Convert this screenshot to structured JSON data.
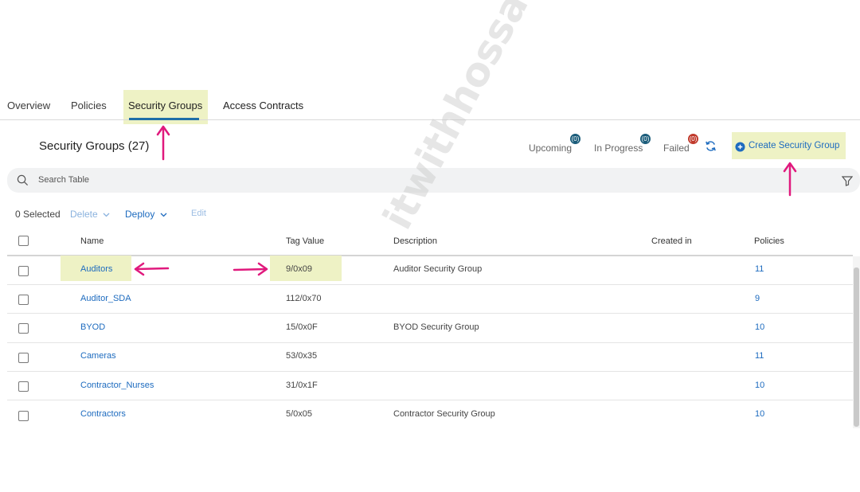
{
  "tabs": [
    {
      "label": "Overview"
    },
    {
      "label": "Policies"
    },
    {
      "label": "Security Groups",
      "active": true
    },
    {
      "label": "Access Contracts"
    }
  ],
  "header": {
    "title": "Security Groups (27)",
    "upcoming_label": "Upcoming",
    "upcoming_count": "(0)",
    "inprogress_label": "In Progress",
    "inprogress_count": "(0)",
    "failed_label": "Failed",
    "failed_count": "(0)",
    "create_label": "Create Security Group"
  },
  "search": {
    "placeholder": "Search Table"
  },
  "toolbar": {
    "selected": "0 Selected",
    "delete": "Delete",
    "deploy": "Deploy",
    "edit": "Edit"
  },
  "table": {
    "columns": [
      "Name",
      "Tag Value",
      "Description",
      "Created in",
      "Policies"
    ],
    "rows": [
      {
        "name": "Auditors",
        "tag": "9/0x09",
        "description": "Auditor Security Group",
        "created": "",
        "policies": "11"
      },
      {
        "name": "Auditor_SDA",
        "tag": "112/0x70",
        "description": "",
        "created": "",
        "policies": "9"
      },
      {
        "name": "BYOD",
        "tag": "15/0x0F",
        "description": "BYOD Security Group",
        "created": "",
        "policies": "10"
      },
      {
        "name": "Cameras",
        "tag": "53/0x35",
        "description": "",
        "created": "",
        "policies": "11"
      },
      {
        "name": "Contractor_Nurses",
        "tag": "31/0x1F",
        "description": "",
        "created": "",
        "policies": "10"
      },
      {
        "name": "Contractors",
        "tag": "5/0x05",
        "description": "Contractor Security Group",
        "created": "",
        "policies": "10"
      }
    ]
  },
  "watermark": "itwithhossam.com",
  "colors": {
    "accent": "#1d6bbf",
    "highlight": "#eef2c5",
    "annotation_arrow": "#e0197d",
    "failed_badge": "#c0392b",
    "status_badge": "#1a5c7a"
  },
  "icons": [
    "search-icon",
    "filter-icon",
    "refresh-icon",
    "plus-circle-icon",
    "chevron-down-icon"
  ]
}
